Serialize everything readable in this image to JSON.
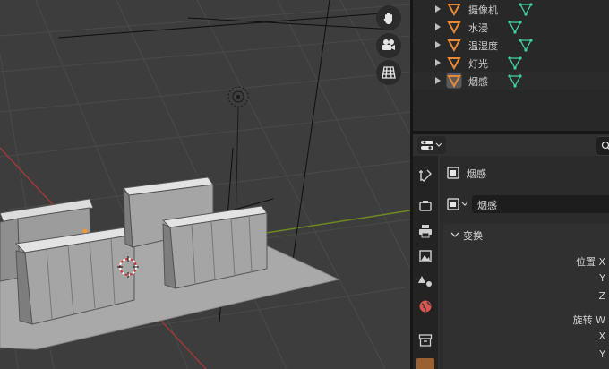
{
  "outliner": {
    "items": [
      {
        "label": "摄像机"
      },
      {
        "label": "水浸"
      },
      {
        "label": "温湿度"
      },
      {
        "label": "灯光"
      },
      {
        "label": "烟感"
      }
    ]
  },
  "properties": {
    "object_name": "烟感",
    "name_field": "烟感",
    "section": "变换",
    "rows": {
      "location_x": "位置 X",
      "location_y": "Y",
      "location_z": "Z",
      "rotation_w": "旋转 W",
      "rotation_x": "X",
      "rotation_y": "Y"
    }
  },
  "colors": {
    "viewport_bg": "#3d3d3d",
    "grid": "#4a4a4a",
    "axis_x": "#9b3a3a",
    "axis_y": "#6b8a23",
    "mesh_icon": "#3fd2a0",
    "object_icon": "#e8893a"
  }
}
